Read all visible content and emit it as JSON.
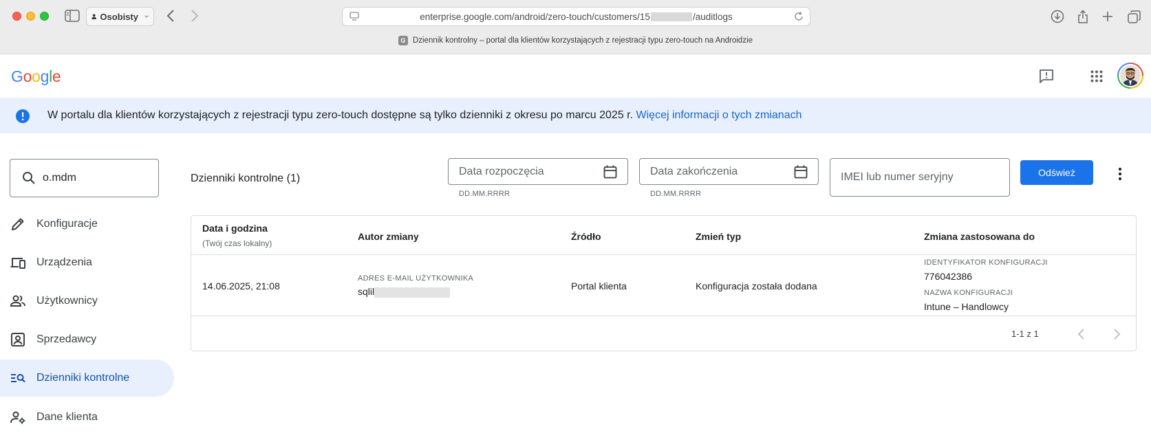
{
  "browser": {
    "profile_label": "Osobisty",
    "url_prefix": "enterprise.google.com/android/zero-touch/customers/15",
    "url_suffix": "/auditlogs",
    "tab_favicon_letter": "G",
    "tab_title": "Dziennik kontrolny – portal dla klientów korzystających z rejestracji typu zero-touch na Androidzie"
  },
  "header": {
    "logo_letters": [
      "G",
      "o",
      "o",
      "g",
      "l",
      "e"
    ],
    "icons": [
      "feedback-icon",
      "apps-grid-icon",
      "avatar"
    ]
  },
  "banner": {
    "message": "W portalu dla klientów korzystających z rejestracji typu zero-touch dostępne są tylko dzienniki z okresu po marcu 2025 r.",
    "link_text": "Więcej informacji o tych zmianach",
    "accent_color": "#1967d2"
  },
  "sidebar": {
    "search_value": "o.mdm",
    "items": [
      {
        "label": "Konfiguracje",
        "icon": "pencil-icon"
      },
      {
        "label": "Urządzenia",
        "icon": "devices-icon"
      },
      {
        "label": "Użytkownicy",
        "icon": "users-icon"
      },
      {
        "label": "Sprzedawcy",
        "icon": "reseller-icon"
      },
      {
        "label": "Dzienniki kontrolne",
        "icon": "audit-log-icon",
        "active": true
      },
      {
        "label": "Dane klienta",
        "icon": "customer-settings-icon"
      }
    ]
  },
  "toolbar": {
    "title": "Dzienniki kontrolne (1)",
    "start_date_placeholder": "Data rozpoczęcia",
    "start_date_hint": "DD.MM.RRRR",
    "end_date_placeholder": "Data zakończenia",
    "end_date_hint": "DD.MM.RRRR",
    "imei_placeholder": "IMEI lub numer seryjny",
    "refresh_label": "Odśwież",
    "refresh_color": "#1a73e8"
  },
  "table": {
    "headers": {
      "datetime": "Data i godzina",
      "datetime_sub": "(Twój czas lokalny)",
      "author": "Autor zmiany",
      "source": "Źródło",
      "change_type": "Zmień typ",
      "applied_to": "Zmiana zastosowana do"
    },
    "rows": [
      {
        "datetime": "14.06.2025, 21:08",
        "author_caption": "ADRES E-MAIL UŻYTKOWNIKA",
        "author_value": "sqlil",
        "source": "Portal klienta",
        "change_type": "Konfiguracja została dodana",
        "config_id_caption": "IDENTYFIKATOR KONFIGURACJI",
        "config_id": "776042386",
        "config_name_caption": "NAZWA KONFIGURACJI",
        "config_name": "Intune – Handlowcy"
      }
    ],
    "pagination": "1-1 z 1"
  }
}
